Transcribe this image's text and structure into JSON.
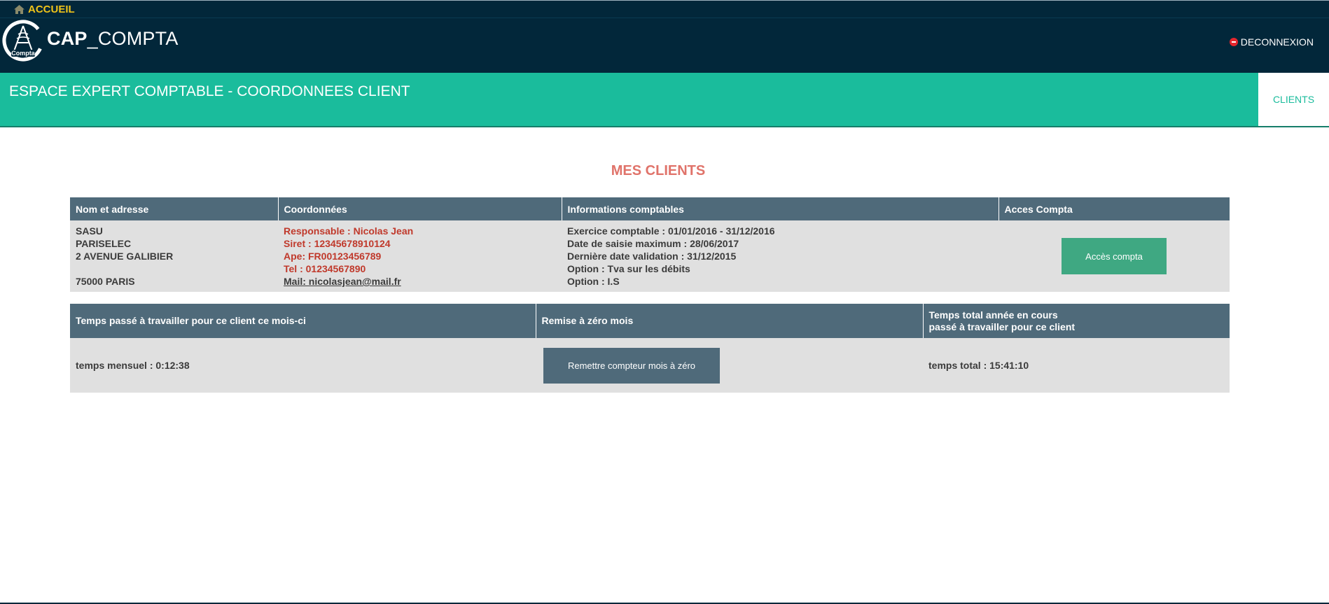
{
  "nav": {
    "home_label": "ACCUEIL",
    "brand_bold": "CAP",
    "brand_rest": "_COMPTA",
    "logo_text": "Compta",
    "logout_label": "DECONNEXION"
  },
  "header": {
    "title": "ESPACE EXPERT COMPTABLE - COORDONNEES CLIENT",
    "clients_tab": "CLIENTS"
  },
  "section_title": "MES CLIENTS",
  "client_table": {
    "columns": [
      "Nom et adresse",
      "Coordonnées",
      "Informations comptables",
      "Acces Compta"
    ],
    "address": [
      "SASU",
      "PARISELEC",
      "2 AVENUE GALIBIER",
      "",
      "75000 PARIS"
    ],
    "contact": {
      "responsable": "Responsable : Nicolas Jean",
      "siret": "Siret : 12345678910124",
      "ape": "Ape: FR00123456789",
      "tel": "Tel : 01234567890",
      "mail": "Mail: nicolasjean@mail.fr"
    },
    "accounting": [
      "Exercice comptable : 01/01/2016 - 31/12/2016",
      "Date de saisie maximum : 28/06/2017",
      "Dernière date validation : 31/12/2015",
      "Option : Tva sur les débits",
      "Option : I.S"
    ],
    "access_button": "Accès compta"
  },
  "time_table": {
    "col1": "Temps passé à travailler pour ce client ce mois-ci",
    "col2": "Remise à zéro mois",
    "col3_line1": "Temps total année en cours",
    "col3_line2": "passé à travailler pour ce client",
    "monthly": "temps mensuel : 0:12:38",
    "reset_button": "Remettre compteur mois à zéro",
    "total": "temps total : 15:41:10"
  },
  "colors": {
    "nav_bg": "#02273a",
    "accent_green": "#1abc9c",
    "header_slate": "#4f6a7a",
    "title_red": "#e0736a",
    "contact_red": "#c0392b",
    "access_button": "#3fa882"
  }
}
